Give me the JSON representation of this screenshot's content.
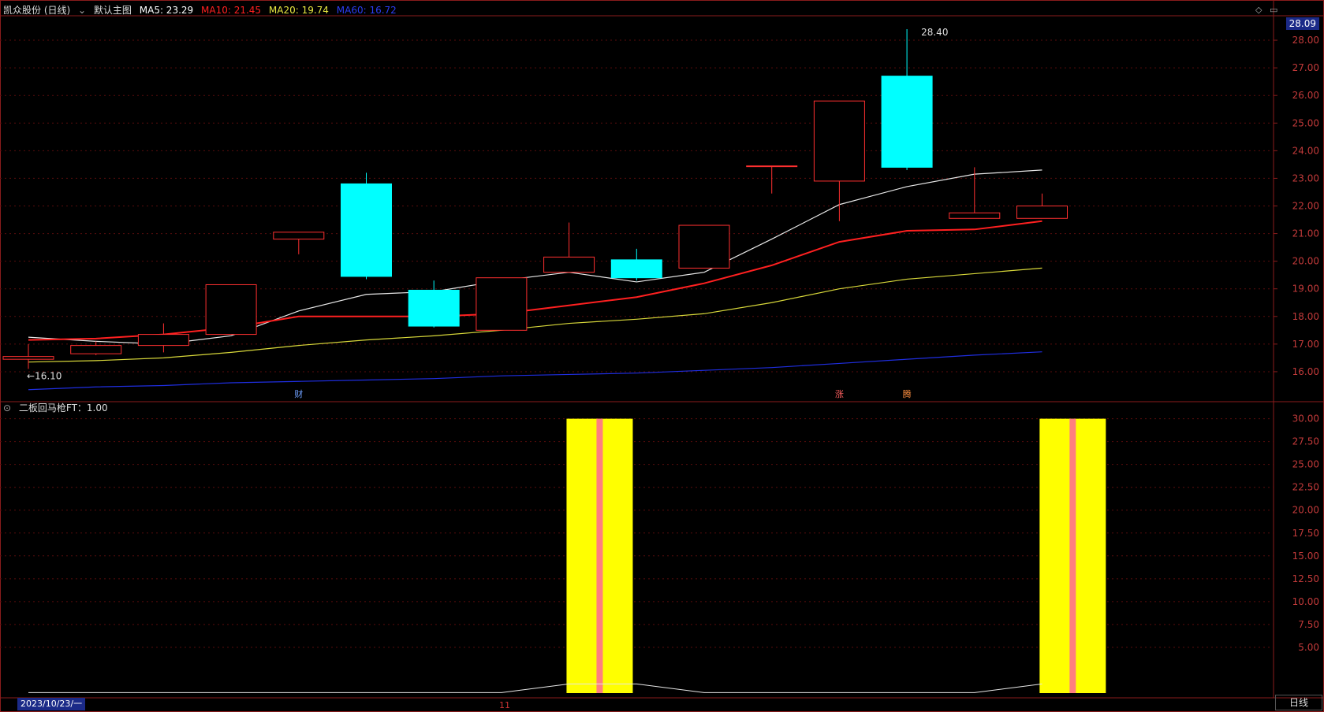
{
  "header": {
    "stock": "凯众股份 (日线)",
    "template": "默认主图",
    "ma5_label": "MA5: 23.29",
    "ma10_label": "MA10: 21.45",
    "ma20_label": "MA20: 19.74",
    "ma60_label": "MA60: 16.72",
    "colors": {
      "ma5": "#ffffff",
      "ma10": "#ff2020",
      "ma20": "#e6e640",
      "ma60": "#1f2ee0"
    }
  },
  "indicator_header": {
    "label": "二板回马枪FT：1.00"
  },
  "price_tag": "28.09",
  "bottom": {
    "date": "2023/10/23/一",
    "month": "11",
    "period_tab": "日线"
  },
  "annotations": {
    "high": "28.40",
    "low": "←16.10",
    "markers": [
      "财",
      "涨",
      "腾"
    ]
  },
  "chart_data": [
    {
      "type": "candlestick",
      "ylim": [
        15.2,
        28.6
      ],
      "yticks": [
        16,
        17,
        18,
        19,
        20,
        21,
        22,
        23,
        24,
        25,
        26,
        27,
        28
      ],
      "ytick_labels": [
        "16.00",
        "17.00",
        "18.00",
        "19.00",
        "20.00",
        "21.00",
        "22.00",
        "23.00",
        "24.00",
        "25.00",
        "26.00",
        "27.00",
        "28.00"
      ],
      "candles": [
        {
          "o": 16.45,
          "c": 16.55,
          "h": 17.0,
          "l": 16.1
        },
        {
          "o": 16.65,
          "c": 16.95,
          "h": 17.1,
          "l": 16.6
        },
        {
          "o": 16.95,
          "c": 17.35,
          "h": 17.75,
          "l": 16.7
        },
        {
          "o": 17.35,
          "c": 19.15,
          "h": 19.15,
          "l": 17.35
        },
        {
          "o": 20.8,
          "c": 21.05,
          "h": 21.05,
          "l": 20.25
        },
        {
          "o": 22.8,
          "c": 19.45,
          "h": 23.2,
          "l": 19.35
        },
        {
          "o": 18.95,
          "c": 17.65,
          "h": 19.3,
          "l": 17.6
        },
        {
          "o": 17.5,
          "c": 19.4,
          "h": 19.4,
          "l": 17.5
        },
        {
          "o": 19.6,
          "c": 20.15,
          "h": 21.4,
          "l": 19.6
        },
        {
          "o": 20.05,
          "c": 19.4,
          "h": 20.45,
          "l": 19.3
        },
        {
          "o": 19.75,
          "c": 21.3,
          "h": 21.3,
          "l": 19.75
        },
        {
          "o": 23.45,
          "c": 23.45,
          "h": 23.45,
          "l": 22.45
        },
        {
          "o": 22.9,
          "c": 25.8,
          "h": 25.8,
          "l": 21.45
        },
        {
          "o": 26.7,
          "c": 23.4,
          "h": 28.4,
          "l": 23.3
        },
        {
          "o": 21.55,
          "c": 21.75,
          "h": 23.4,
          "l": 21.55
        },
        {
          "o": 21.55,
          "c": 22.0,
          "h": 22.45,
          "l": 21.55
        }
      ],
      "series": [
        {
          "name": "MA5",
          "values": [
            17.25,
            17.1,
            17.0,
            17.3,
            18.2,
            18.8,
            18.9,
            19.3,
            19.6,
            19.25,
            19.6,
            20.8,
            22.05,
            22.7,
            23.15,
            23.3
          ]
        },
        {
          "name": "MA10",
          "values": [
            17.15,
            17.2,
            17.35,
            17.6,
            18.0,
            18.0,
            18.0,
            18.1,
            18.4,
            18.7,
            19.2,
            19.85,
            20.7,
            21.1,
            21.15,
            21.45
          ]
        },
        {
          "name": "MA20",
          "values": [
            16.35,
            16.4,
            16.5,
            16.7,
            16.95,
            17.15,
            17.3,
            17.5,
            17.75,
            17.9,
            18.1,
            18.5,
            19.0,
            19.35,
            19.55,
            19.75
          ]
        },
        {
          "name": "MA60",
          "values": [
            15.35,
            15.45,
            15.5,
            15.6,
            15.65,
            15.7,
            15.75,
            15.85,
            15.9,
            15.95,
            16.05,
            16.15,
            16.3,
            16.45,
            16.6,
            16.72
          ]
        }
      ]
    },
    {
      "type": "bar",
      "ylim": [
        0,
        31
      ],
      "yticks": [
        5,
        7.5,
        10,
        12.5,
        15,
        17.5,
        20,
        22.5,
        25,
        27.5,
        30
      ],
      "ytick_labels": [
        "5.00",
        "7.50",
        "10.00",
        "12.50",
        "15.00",
        "17.50",
        "20.00",
        "22.50",
        "25.00",
        "27.50",
        "30.00"
      ],
      "bars": [
        {
          "index": 8,
          "value": 30
        },
        {
          "index": 15,
          "value": 30
        }
      ],
      "line_values": [
        0.05,
        0.05,
        0.05,
        0.05,
        0.05,
        0.05,
        0.05,
        0.05,
        1.0,
        1.0,
        0.05,
        0.05,
        0.05,
        0.05,
        0.05,
        1.0
      ]
    }
  ]
}
